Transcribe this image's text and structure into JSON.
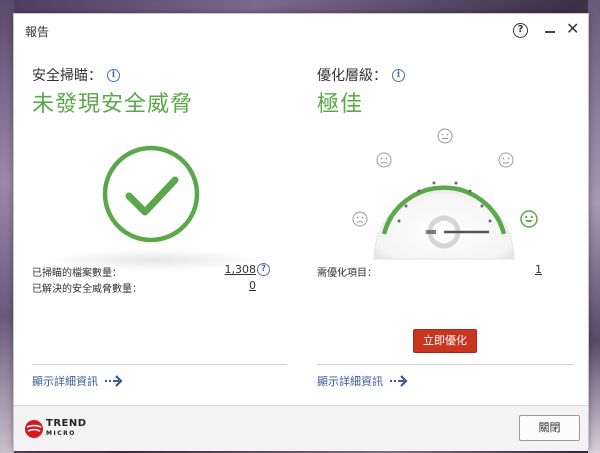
{
  "window": {
    "title": "報告",
    "help_label": "?",
    "close_label": "✕"
  },
  "security": {
    "label": "安全掃瞄：",
    "status": "未發現安全威脅",
    "scanned_label": "已掃瞄的檔案數量：",
    "scanned_value": "1,308",
    "resolved_label": "已解決的安全威脅數量：",
    "resolved_value": "0",
    "details_label": "顯示詳細資訊"
  },
  "optimization": {
    "label": "優化層級：",
    "status": "極佳",
    "items_label": "需優化項目：",
    "items_value": "1",
    "optimize_button": "立即優化",
    "details_label": "顯示詳細資訊",
    "gauge_level": "excellent"
  },
  "footer": {
    "logo_line1": "TREND",
    "logo_line2": "MICRO",
    "close_button": "關閉"
  },
  "colors": {
    "accent_green": "#5aa84a",
    "link_blue": "#3c5a9a",
    "optimize_red": "#c9361f",
    "logo_red": "#d71920"
  },
  "icons": {
    "info": "info-icon",
    "help": "question-circle-icon",
    "check": "checkmark-circle-icon",
    "arrow": "dotted-arrow-right-icon",
    "face": "smiley-face-icon"
  }
}
